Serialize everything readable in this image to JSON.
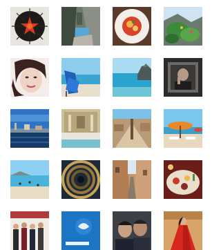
{
  "gallery": {
    "rows": 5,
    "columns": 4,
    "thumbnails": [
      {
        "subject": "sea-urchin-food"
      },
      {
        "subject": "coastal-cliff-path"
      },
      {
        "subject": "pasta-plate"
      },
      {
        "subject": "green-shrub-rocks"
      },
      {
        "subject": "woman-portrait"
      },
      {
        "subject": "beach-chair-sea"
      },
      {
        "subject": "sea-and-rock-island"
      },
      {
        "subject": "framed-portrait-painting"
      },
      {
        "subject": "venice-waterfront"
      },
      {
        "subject": "baroque-fountain"
      },
      {
        "subject": "piazza-aerial-view"
      },
      {
        "subject": "beach-umbrellas"
      },
      {
        "subject": "bay-with-swimmers"
      },
      {
        "subject": "spiral-staircase"
      },
      {
        "subject": "narrow-city-street"
      },
      {
        "subject": "festive-dinner-table"
      },
      {
        "subject": "group-photo"
      },
      {
        "subject": "blue-event-banner"
      },
      {
        "subject": "two-men-selfie"
      },
      {
        "subject": "red-dress-figure"
      }
    ]
  }
}
